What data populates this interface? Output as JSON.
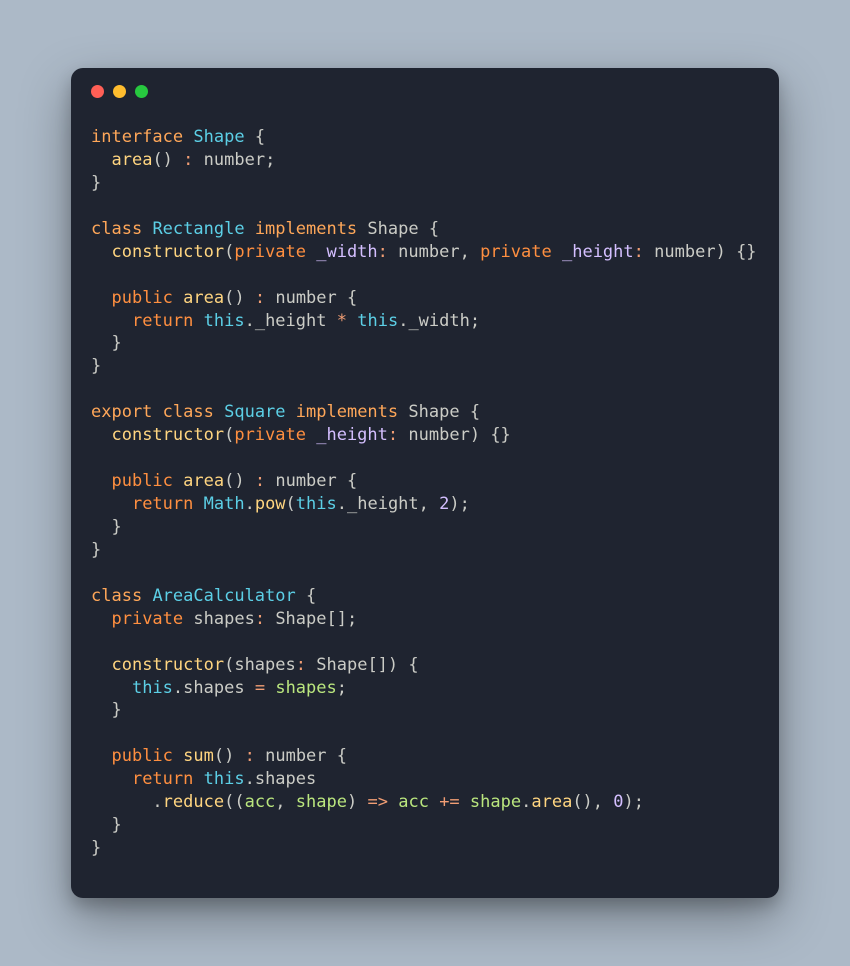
{
  "window": {
    "buttons": [
      "close",
      "minimize",
      "zoom"
    ]
  },
  "code": {
    "tokens": [
      [
        [
          "kw1",
          "interface"
        ],
        [
          "",
          null
        ],
        [
          "type",
          "Shape"
        ],
        [
          "",
          null
        ],
        [
          "punc",
          "{"
        ]
      ],
      [
        [
          "",
          "  "
        ],
        [
          "fn",
          "area"
        ],
        [
          "punc",
          "()"
        ],
        [
          "",
          null
        ],
        [
          "op",
          ":"
        ],
        [
          "",
          null
        ],
        [
          "ident",
          "number"
        ],
        [
          "punc",
          ";"
        ]
      ],
      [
        [
          "punc",
          "}"
        ]
      ],
      [],
      [
        [
          "kw1",
          "class"
        ],
        [
          "",
          null
        ],
        [
          "type",
          "Rectangle"
        ],
        [
          "",
          null
        ],
        [
          "kw1",
          "implements"
        ],
        [
          "",
          null
        ],
        [
          "ident",
          "Shape"
        ],
        [
          "",
          null
        ],
        [
          "punc",
          "{"
        ]
      ],
      [
        [
          "",
          "  "
        ],
        [
          "fn",
          "constructor"
        ],
        [
          "punc",
          "("
        ],
        [
          "kw2",
          "private"
        ],
        [
          "",
          null
        ],
        [
          "param",
          "_width"
        ],
        [
          "op",
          ":"
        ],
        [
          "",
          null
        ],
        [
          "ident",
          "number"
        ],
        [
          "punc",
          ","
        ],
        [
          "",
          null
        ],
        [
          "kw2",
          "private"
        ],
        [
          "",
          null
        ],
        [
          "param",
          "_height"
        ],
        [
          "op",
          ":"
        ],
        [
          "",
          null
        ],
        [
          "ident",
          "number"
        ],
        [
          "punc",
          ")"
        ],
        [
          "",
          null
        ],
        [
          "punc",
          "{}"
        ]
      ],
      [],
      [
        [
          "",
          "  "
        ],
        [
          "kw2",
          "public"
        ],
        [
          "",
          null
        ],
        [
          "fn",
          "area"
        ],
        [
          "punc",
          "()"
        ],
        [
          "",
          null
        ],
        [
          "op",
          ":"
        ],
        [
          "",
          null
        ],
        [
          "ident",
          "number"
        ],
        [
          "",
          null
        ],
        [
          "punc",
          "{"
        ]
      ],
      [
        [
          "",
          "    "
        ],
        [
          "kw3",
          "return"
        ],
        [
          "",
          null
        ],
        [
          "this",
          "this"
        ],
        [
          "punc",
          "."
        ],
        [
          "ident",
          "_height"
        ],
        [
          "",
          null
        ],
        [
          "op",
          "*"
        ],
        [
          "",
          null
        ],
        [
          "this",
          "this"
        ],
        [
          "punc",
          "."
        ],
        [
          "ident",
          "_width"
        ],
        [
          "punc",
          ";"
        ]
      ],
      [
        [
          "",
          "  "
        ],
        [
          "punc",
          "}"
        ]
      ],
      [
        [
          "punc",
          "}"
        ]
      ],
      [],
      [
        [
          "kw1",
          "export"
        ],
        [
          "",
          null
        ],
        [
          "kw1",
          "class"
        ],
        [
          "",
          null
        ],
        [
          "type",
          "Square"
        ],
        [
          "",
          null
        ],
        [
          "kw1",
          "implements"
        ],
        [
          "",
          null
        ],
        [
          "ident",
          "Shape"
        ],
        [
          "",
          null
        ],
        [
          "punc",
          "{"
        ]
      ],
      [
        [
          "",
          "  "
        ],
        [
          "fn",
          "constructor"
        ],
        [
          "punc",
          "("
        ],
        [
          "kw2",
          "private"
        ],
        [
          "",
          null
        ],
        [
          "param",
          "_height"
        ],
        [
          "op",
          ":"
        ],
        [
          "",
          null
        ],
        [
          "ident",
          "number"
        ],
        [
          "punc",
          ")"
        ],
        [
          "",
          null
        ],
        [
          "punc",
          "{}"
        ]
      ],
      [],
      [
        [
          "",
          "  "
        ],
        [
          "kw2",
          "public"
        ],
        [
          "",
          null
        ],
        [
          "fn",
          "area"
        ],
        [
          "punc",
          "()"
        ],
        [
          "",
          null
        ],
        [
          "op",
          ":"
        ],
        [
          "",
          null
        ],
        [
          "ident",
          "number"
        ],
        [
          "",
          null
        ],
        [
          "punc",
          "{"
        ]
      ],
      [
        [
          "",
          "    "
        ],
        [
          "kw3",
          "return"
        ],
        [
          "",
          null
        ],
        [
          "type",
          "Math"
        ],
        [
          "punc",
          "."
        ],
        [
          "prop",
          "pow"
        ],
        [
          "punc",
          "("
        ],
        [
          "this",
          "this"
        ],
        [
          "punc",
          "."
        ],
        [
          "ident",
          "_height"
        ],
        [
          "punc",
          ","
        ],
        [
          "",
          null
        ],
        [
          "num",
          "2"
        ],
        [
          "punc",
          ")"
        ],
        [
          "punc",
          ";"
        ]
      ],
      [
        [
          "",
          "  "
        ],
        [
          "punc",
          "}"
        ]
      ],
      [
        [
          "punc",
          "}"
        ]
      ],
      [],
      [
        [
          "kw1",
          "class"
        ],
        [
          "",
          null
        ],
        [
          "type",
          "AreaCalculator"
        ],
        [
          "",
          null
        ],
        [
          "punc",
          "{"
        ]
      ],
      [
        [
          "",
          "  "
        ],
        [
          "kw2",
          "private"
        ],
        [
          "",
          null
        ],
        [
          "ident",
          "shapes"
        ],
        [
          "op",
          ":"
        ],
        [
          "",
          null
        ],
        [
          "ident",
          "Shape"
        ],
        [
          "punc",
          "[]"
        ],
        [
          "punc",
          ";"
        ]
      ],
      [],
      [
        [
          "",
          "  "
        ],
        [
          "fn",
          "constructor"
        ],
        [
          "punc",
          "("
        ],
        [
          "ident",
          "shapes"
        ],
        [
          "op",
          ":"
        ],
        [
          "",
          null
        ],
        [
          "ident",
          "Shape"
        ],
        [
          "punc",
          "[])"
        ],
        [
          "",
          null
        ],
        [
          "punc",
          "{"
        ]
      ],
      [
        [
          "",
          "    "
        ],
        [
          "this",
          "this"
        ],
        [
          "punc",
          "."
        ],
        [
          "ident",
          "shapes"
        ],
        [
          "",
          null
        ],
        [
          "op",
          "="
        ],
        [
          "",
          null
        ],
        [
          "var",
          "shapes"
        ],
        [
          "punc",
          ";"
        ]
      ],
      [
        [
          "",
          "  "
        ],
        [
          "punc",
          "}"
        ]
      ],
      [],
      [
        [
          "",
          "  "
        ],
        [
          "kw2",
          "public"
        ],
        [
          "",
          null
        ],
        [
          "fn",
          "sum"
        ],
        [
          "punc",
          "()"
        ],
        [
          "",
          null
        ],
        [
          "op",
          ":"
        ],
        [
          "",
          null
        ],
        [
          "ident",
          "number"
        ],
        [
          "",
          null
        ],
        [
          "punc",
          "{"
        ]
      ],
      [
        [
          "",
          "    "
        ],
        [
          "kw3",
          "return"
        ],
        [
          "",
          null
        ],
        [
          "this",
          "this"
        ],
        [
          "punc",
          "."
        ],
        [
          "ident",
          "shapes"
        ]
      ],
      [
        [
          "",
          "      "
        ],
        [
          "punc",
          "."
        ],
        [
          "prop",
          "reduce"
        ],
        [
          "punc",
          "(("
        ],
        [
          "var",
          "acc"
        ],
        [
          "punc",
          ","
        ],
        [
          "",
          null
        ],
        [
          "var",
          "shape"
        ],
        [
          "punc",
          ")"
        ],
        [
          "",
          null
        ],
        [
          "op",
          "=>"
        ],
        [
          "",
          null
        ],
        [
          "var",
          "acc"
        ],
        [
          "",
          null
        ],
        [
          "op",
          "+="
        ],
        [
          "",
          null
        ],
        [
          "var",
          "shape"
        ],
        [
          "punc",
          "."
        ],
        [
          "prop",
          "area"
        ],
        [
          "punc",
          "()"
        ],
        [
          "punc",
          ","
        ],
        [
          "",
          null
        ],
        [
          "num",
          "0"
        ],
        [
          "punc",
          ")"
        ],
        [
          "punc",
          ";"
        ]
      ],
      [
        [
          "",
          "  "
        ],
        [
          "punc",
          "}"
        ]
      ],
      [
        [
          "punc",
          "}"
        ]
      ]
    ]
  }
}
